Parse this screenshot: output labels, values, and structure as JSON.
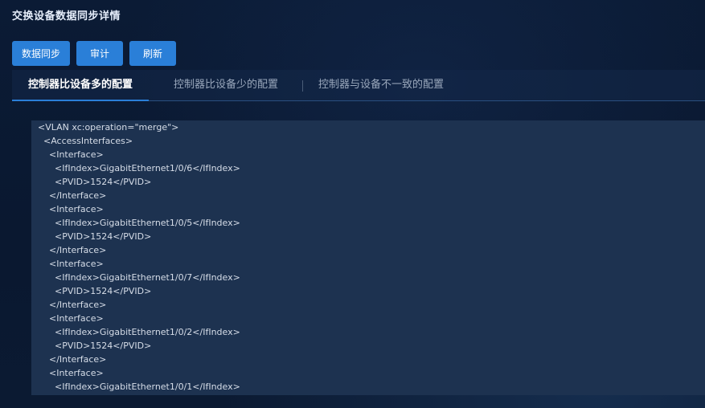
{
  "page": {
    "title": "交换设备数据同步详情"
  },
  "toolbar": {
    "sync_label": "数据同步",
    "audit_label": "审计",
    "refresh_label": "刷新"
  },
  "tabs": [
    {
      "label": "控制器比设备多的配置",
      "active": true
    },
    {
      "label": "控制器比设备少的配置",
      "active": false
    },
    {
      "label": "控制器与设备不一致的配置",
      "active": false
    }
  ],
  "config_lines": [
    {
      "indent": 0,
      "text": "<VLAN xc:operation=\"merge\">"
    },
    {
      "indent": 1,
      "text": "<AccessInterfaces>"
    },
    {
      "indent": 2,
      "text": "<Interface>"
    },
    {
      "indent": 3,
      "text": "<IfIndex>GigabitEthernet1/0/6</IfIndex>"
    },
    {
      "indent": 3,
      "text": "<PVID>1524</PVID>"
    },
    {
      "indent": 2,
      "text": "</Interface>"
    },
    {
      "indent": 2,
      "text": "<Interface>"
    },
    {
      "indent": 3,
      "text": "<IfIndex>GigabitEthernet1/0/5</IfIndex>"
    },
    {
      "indent": 3,
      "text": "<PVID>1524</PVID>"
    },
    {
      "indent": 2,
      "text": "</Interface>"
    },
    {
      "indent": 2,
      "text": "<Interface>"
    },
    {
      "indent": 3,
      "text": "<IfIndex>GigabitEthernet1/0/7</IfIndex>"
    },
    {
      "indent": 3,
      "text": "<PVID>1524</PVID>"
    },
    {
      "indent": 2,
      "text": "</Interface>"
    },
    {
      "indent": 2,
      "text": "<Interface>"
    },
    {
      "indent": 3,
      "text": "<IfIndex>GigabitEthernet1/0/2</IfIndex>"
    },
    {
      "indent": 3,
      "text": "<PVID>1524</PVID>"
    },
    {
      "indent": 2,
      "text": "</Interface>"
    },
    {
      "indent": 2,
      "text": "<Interface>"
    },
    {
      "indent": 3,
      "text": "<IfIndex>GigabitEthernet1/0/1</IfIndex>"
    }
  ],
  "colors": {
    "accent": "#2a7fd8",
    "background": "#0a1a33",
    "panel": "#1d3250"
  }
}
